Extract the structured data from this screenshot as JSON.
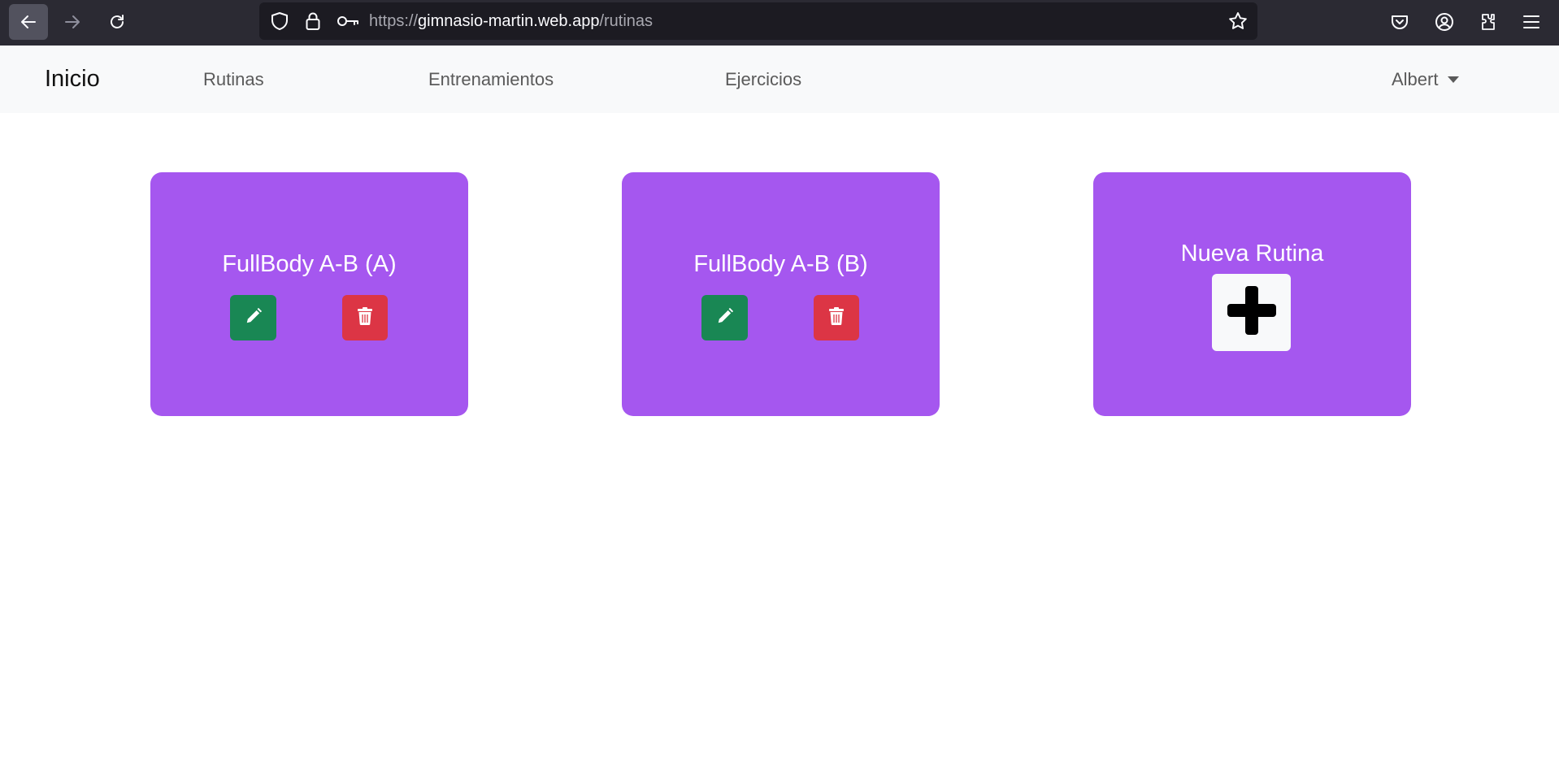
{
  "browser": {
    "url_scheme": "https://",
    "url_host": "gimnasio-martin.web.app",
    "url_path": "/rutinas",
    "icons": [
      "back-arrow-icon",
      "forward-arrow-icon",
      "reload-icon",
      "shield-icon",
      "lock-icon",
      "key-icon",
      "star-icon",
      "pocket-icon",
      "account-icon",
      "extensions-icon",
      "menu-icon"
    ]
  },
  "nav": {
    "brand": "Inicio",
    "links": [
      "Rutinas",
      "Entrenamientos",
      "Ejercicios"
    ],
    "user": "Albert"
  },
  "routines": [
    {
      "title": "FullBody A-B (A)"
    },
    {
      "title": "FullBody A-B (B)"
    }
  ],
  "new_routine": {
    "title": "Nueva Rutina"
  },
  "colors": {
    "card": "#a557ef",
    "edit": "#198754",
    "delete": "#dc3545",
    "toolbar": "#2b2a33",
    "navbar": "#f8f9fa"
  }
}
